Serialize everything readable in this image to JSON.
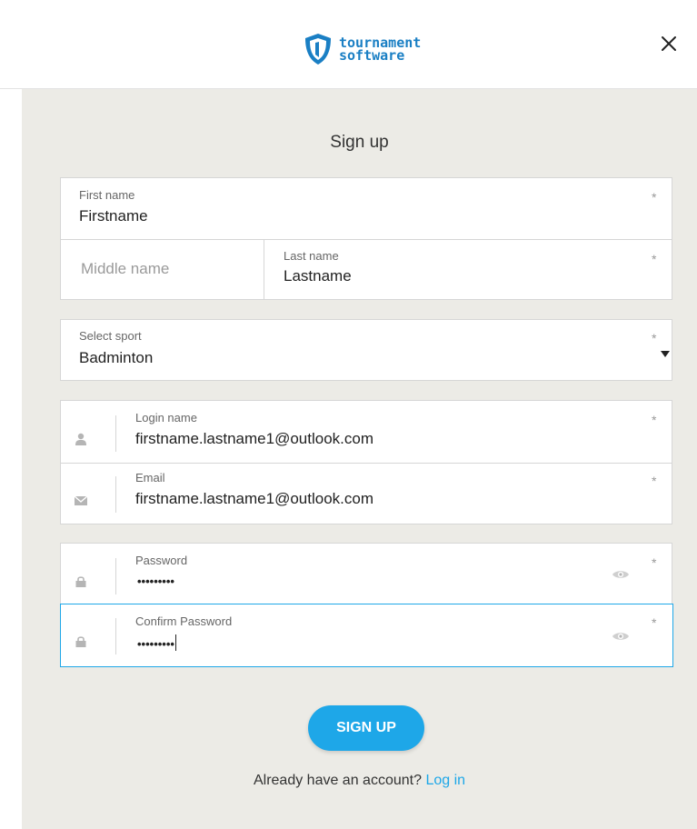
{
  "brand": {
    "line1": "tournament",
    "line2": "software",
    "color": "#1a7fc4"
  },
  "form": {
    "title": "Sign up",
    "required_mark": "*",
    "first_name": {
      "label": "First name",
      "value": "Firstname"
    },
    "middle_name": {
      "placeholder": "Middle name",
      "value": ""
    },
    "last_name": {
      "label": "Last name",
      "value": "Lastname"
    },
    "sport": {
      "label": "Select sport",
      "value": "Badminton"
    },
    "login_name": {
      "label": "Login name",
      "value": "firstname.lastname1@outlook.com",
      "icon": "user-icon"
    },
    "email": {
      "label": "Email",
      "value": "firstname.lastname1@outlook.com",
      "icon": "envelope-icon"
    },
    "password": {
      "label": "Password",
      "masked": "•••••••••",
      "icon": "lock-icon"
    },
    "confirm_password": {
      "label": "Confirm Password",
      "masked": "•••••••••",
      "icon": "lock-icon"
    },
    "submit_label": "SIGN UP",
    "already_text": "Already have an account?",
    "login_link": "Log in"
  },
  "colors": {
    "accent": "#1ea7e8",
    "panel_bg": "#ecebe6",
    "focus_border": "#1ea7e8"
  }
}
